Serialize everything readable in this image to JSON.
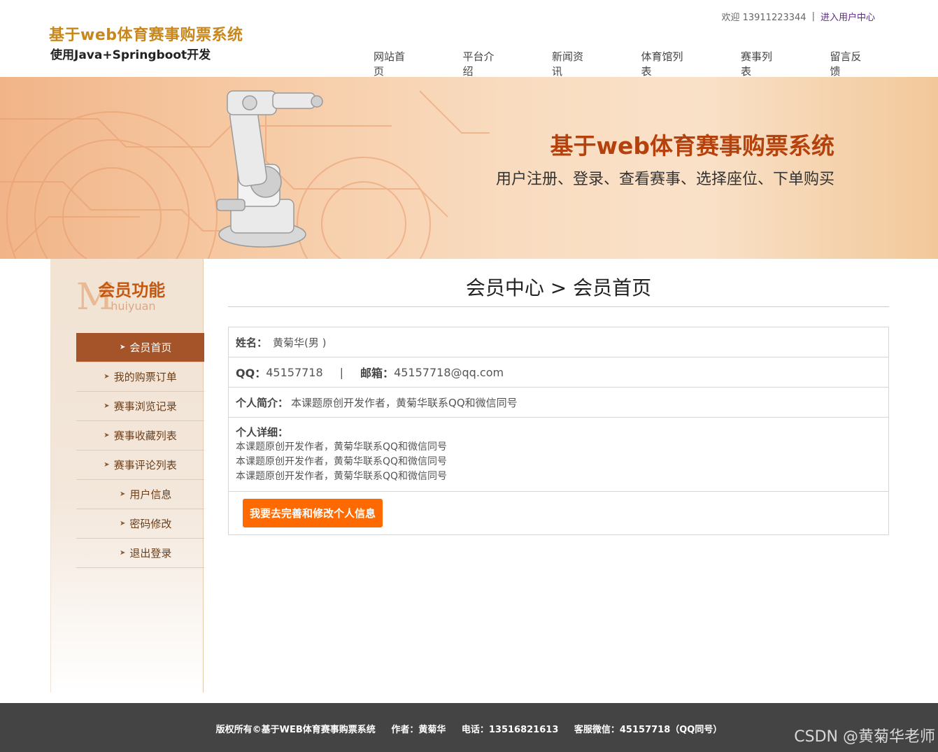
{
  "header": {
    "title": "基于web体育赛事购票系统",
    "subtitle": "使用Java+Springboot开发",
    "welcome": "欢迎 13911223344",
    "separator": "|",
    "user_center_link": "进入用户中心"
  },
  "nav": {
    "items": [
      "网站首页",
      "平台介绍",
      "新闻资讯",
      "体育馆列表",
      "赛事列表",
      "留言反馈"
    ]
  },
  "banner": {
    "title": "基于web体育赛事购票系统",
    "subtitle": "用户注册、登录、查看赛事、选择座位、下单购买"
  },
  "sidebar": {
    "logo_letter": "M",
    "title": "会员功能",
    "title_sub": "huiyuan",
    "items": [
      {
        "label": "会员首页",
        "active": true
      },
      {
        "label": "我的购票订单"
      },
      {
        "label": "赛事浏览记录"
      },
      {
        "label": "赛事收藏列表"
      },
      {
        "label": "赛事评论列表"
      },
      {
        "label": "用户信息"
      },
      {
        "label": "密码修改"
      },
      {
        "label": "退出登录"
      }
    ]
  },
  "main": {
    "page_title": "会员中心 > 会员首页",
    "name_label": "姓名：",
    "name_value": "黄菊华(男 )",
    "qq_label": "QQ：",
    "qq_value": "45157718",
    "divider": "|",
    "email_label": "邮箱：",
    "email_value": "45157718@qq.com",
    "intro_label": "个人简介：",
    "intro_value": "本课题原创开发作者，黄菊华联系QQ和微信同号",
    "detail_label": "个人详细：",
    "detail_lines": [
      "本课题原创开发作者，黄菊华联系QQ和微信同号",
      "本课题原创开发作者，黄菊华联系QQ和微信同号",
      "本课题原创开发作者，黄菊华联系QQ和微信同号"
    ],
    "edit_button": "我要去完善和修改个人信息"
  },
  "footer": {
    "copyright": "版权所有©基于WEB体育赛事购票系统",
    "author": "作者：黄菊华",
    "phone": "电话：13516821613",
    "wechat": "客服微信：45157718（QQ同号）",
    "watermark": "CSDN @黄菊华老师"
  },
  "colors": {
    "brand": "#c8871c",
    "banner_title": "#b5420d",
    "sidebar_active": "#a5542a",
    "button": "#ff6a00",
    "footer_bg": "#444444"
  }
}
